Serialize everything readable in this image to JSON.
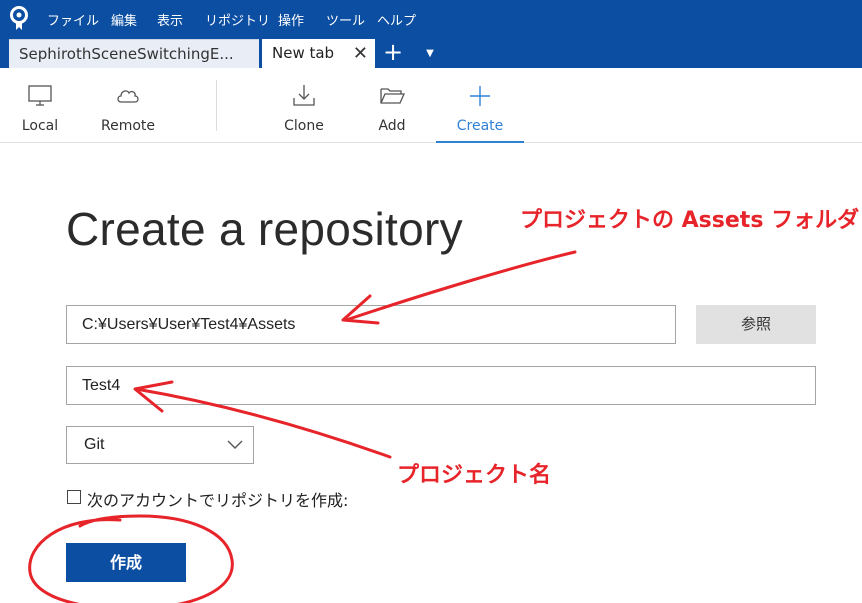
{
  "menubar": {
    "items": [
      "ファイル",
      "編集",
      "表示",
      "リポジトリ",
      "操作",
      "ツール",
      "ヘルプ"
    ]
  },
  "tabs": {
    "items": [
      {
        "label": "SephirothSceneSwitchingE...",
        "active": false
      },
      {
        "label": "New tab",
        "active": true
      }
    ],
    "close_glyph": "✕",
    "add_glyph": "+",
    "menu_glyph": "▼"
  },
  "toolbar": {
    "local": "Local",
    "remote": "Remote",
    "clone": "Clone",
    "add": "Add",
    "create": "Create"
  },
  "main": {
    "title": "Create a repository",
    "path_value": "C:¥Users¥User¥Test4¥Assets",
    "browse_label": "参照",
    "name_value": "Test4",
    "vcs_selected": "Git",
    "account_checkbox_label": "次のアカウントでリポジトリを作成:",
    "account_checkbox_checked": false,
    "create_button_label": "作成"
  },
  "annotations": {
    "assets_note": "プロジェクトの Assets フォルダ",
    "project_note": "プロジェクト名",
    "color": "#e6242a"
  },
  "colors": {
    "brand_blue": "#0b4ea2",
    "accent_blue": "#2f80d6"
  }
}
